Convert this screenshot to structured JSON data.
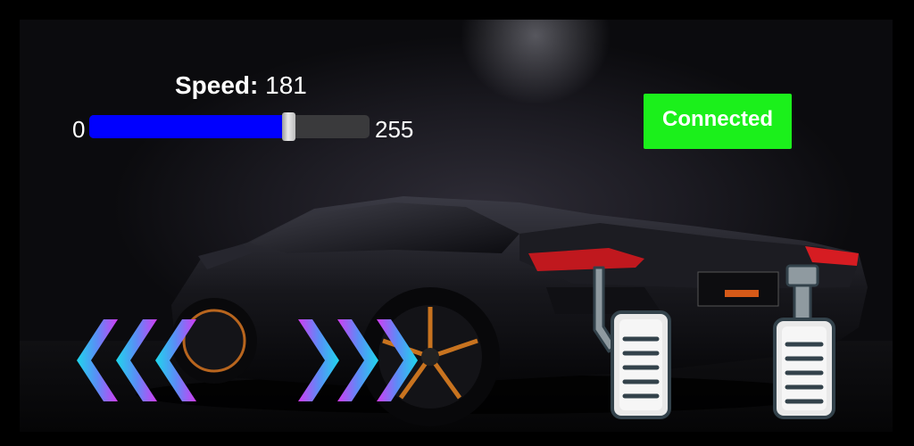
{
  "speed": {
    "label": "Speed:",
    "value": "181",
    "min": "0",
    "max": "255",
    "fraction": 0.71
  },
  "status": {
    "label": "Connected",
    "color": "#1bf01b"
  },
  "controls": {
    "left_icon": "triple-chevron-left-icon",
    "right_icon": "triple-chevron-right-icon",
    "brake_icon": "brake-pedal-icon",
    "gas_icon": "gas-pedal-icon"
  },
  "colors": {
    "slider_fill": "#0000ff",
    "chevron_cyan": "#22d4e8",
    "chevron_purple": "#c040ff"
  }
}
